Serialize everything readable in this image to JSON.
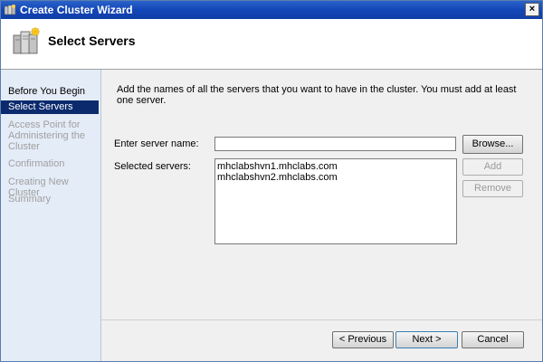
{
  "window": {
    "title": "Create Cluster Wizard",
    "close_glyph": "×"
  },
  "header": {
    "title": "Select Servers"
  },
  "nav": {
    "items": [
      {
        "label": "Before You Begin",
        "state": "normal"
      },
      {
        "label": "Select Servers",
        "state": "selected"
      },
      {
        "label": "Access Point for Administering the Cluster",
        "state": "disabled"
      },
      {
        "label": "Confirmation",
        "state": "disabled"
      },
      {
        "label": "Creating New Cluster",
        "state": "disabled"
      },
      {
        "label": "Summary",
        "state": "disabled"
      }
    ]
  },
  "content": {
    "instructions": "Add the names of all the servers that you want to have in the cluster. You must add at least one server.",
    "server_name_label": "Enter server name:",
    "server_name_value": "",
    "selected_label": "Selected servers:",
    "selected_servers": [
      "mhclabshvn1.mhclabs.com",
      "mhclabshvn2.mhclabs.com"
    ],
    "browse_label": "Browse...",
    "add_label": "Add",
    "remove_label": "Remove"
  },
  "footer": {
    "previous_label": "< Previous",
    "next_label": "Next >",
    "cancel_label": "Cancel"
  },
  "colors": {
    "titlebar": "#1346b8",
    "nav_background": "#e4ecf7",
    "nav_selected": "#0b2a6e"
  }
}
